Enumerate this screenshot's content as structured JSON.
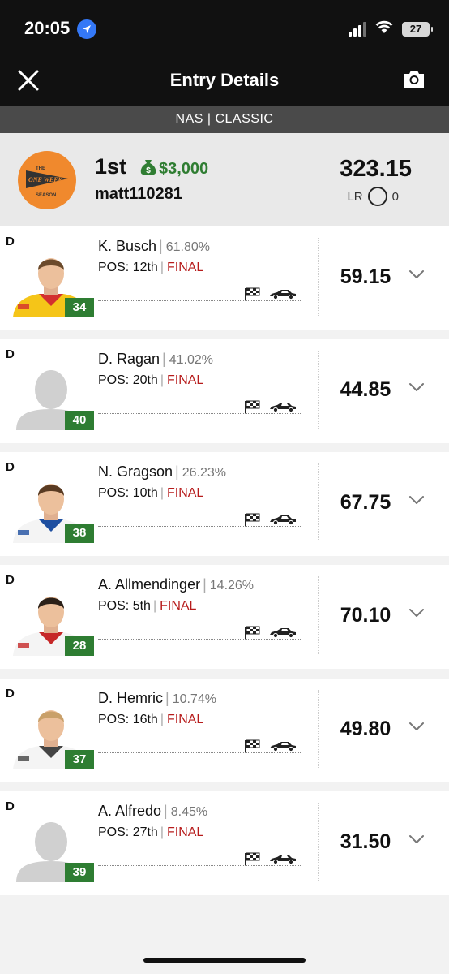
{
  "status_bar": {
    "time": "20:05",
    "battery": "27"
  },
  "nav": {
    "title": "Entry Details"
  },
  "contest": {
    "label": "NAS | CLASSIC"
  },
  "entry": {
    "place": "1st",
    "prize": "$3,000",
    "username": "matt110281",
    "total_points": "323.15",
    "lr_label": "LR",
    "lr_value": "0",
    "logo_text_top": "THE",
    "logo_text_main": "ONE WEEK",
    "logo_text_bottom": "SEASON"
  },
  "players": [
    {
      "slot": "D",
      "name": "K. Busch",
      "ownership": "61.80%",
      "pos_label": "POS:",
      "pos": "12th",
      "status": "FINAL",
      "points": "59.15",
      "car": "34",
      "photo": "driver-yellow"
    },
    {
      "slot": "D",
      "name": "D. Ragan",
      "ownership": "41.02%",
      "pos_label": "POS:",
      "pos": "20th",
      "status": "FINAL",
      "points": "44.85",
      "car": "40",
      "photo": "placeholder"
    },
    {
      "slot": "D",
      "name": "N. Gragson",
      "ownership": "26.23%",
      "pos_label": "POS:",
      "pos": "10th",
      "status": "FINAL",
      "points": "67.75",
      "car": "38",
      "photo": "driver-white-blue"
    },
    {
      "slot": "D",
      "name": "A. Allmendinger",
      "ownership": "14.26%",
      "pos_label": "POS:",
      "pos": "5th",
      "status": "FINAL",
      "points": "70.10",
      "car": "28",
      "photo": "driver-white-red"
    },
    {
      "slot": "D",
      "name": "D. Hemric",
      "ownership": "10.74%",
      "pos_label": "POS:",
      "pos": "16th",
      "status": "FINAL",
      "points": "49.80",
      "car": "37",
      "photo": "driver-white"
    },
    {
      "slot": "D",
      "name": "A. Alfredo",
      "ownership": "8.45%",
      "pos_label": "POS:",
      "pos": "27th",
      "status": "FINAL",
      "points": "31.50",
      "car": "39",
      "photo": "placeholder"
    }
  ],
  "colors": {
    "header_bg": "#111111",
    "subheader_bg": "#4a4a4a",
    "prize_green": "#2f7d32",
    "badge_green": "#2e7d32",
    "final_red": "#b71c1c",
    "logo_orange": "#f0892d",
    "location_blue": "#3478f6"
  }
}
